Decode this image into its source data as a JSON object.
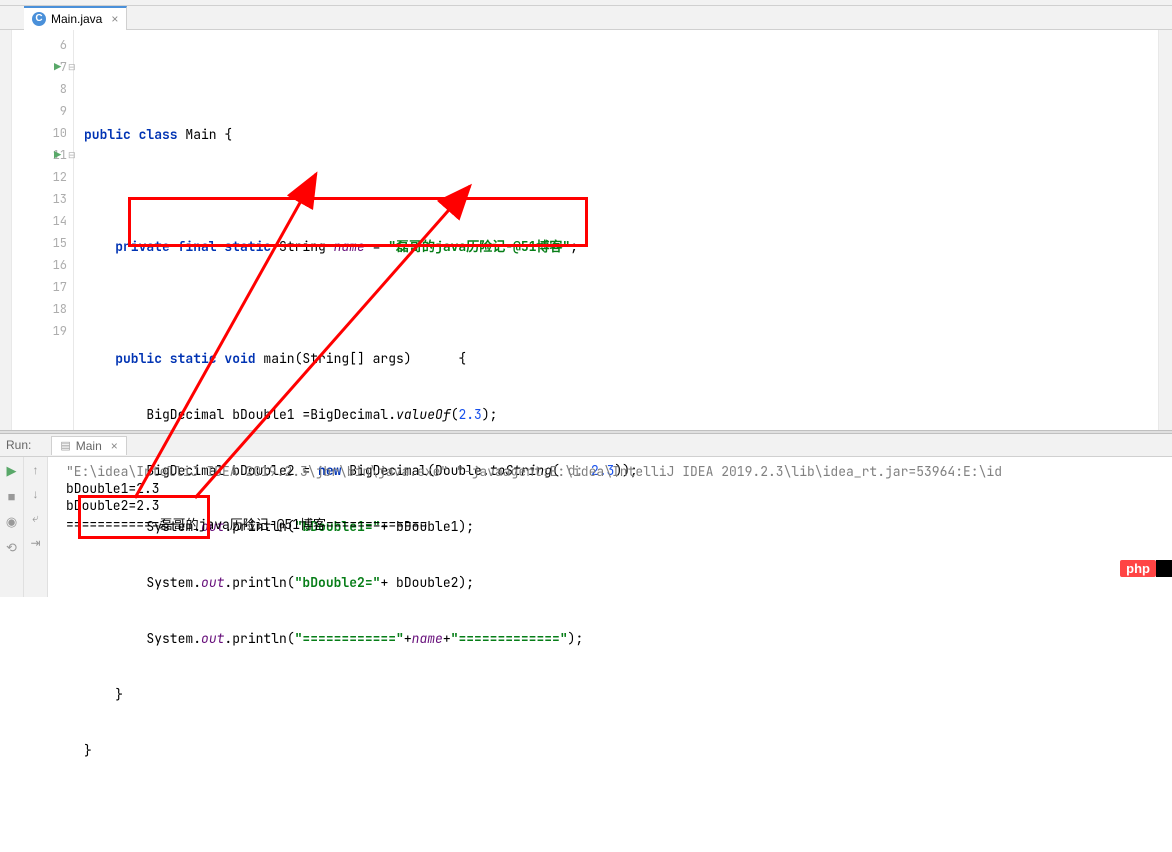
{
  "tab": {
    "label": "Main.java"
  },
  "gutter": [
    "6",
    "7",
    "8",
    "9",
    "10",
    "11",
    "12",
    "13",
    "14",
    "15",
    "16",
    "17",
    "18",
    "19",
    ""
  ],
  "run_markers": {
    "7": true,
    "11": true
  },
  "code": {
    "l7": {
      "a": "public class ",
      "b": "Main {"
    },
    "l9": {
      "a": "private final static ",
      "b": "String ",
      "c": "name",
      "d": " = ",
      "e": "\"磊哥的java历险记-@51博客\"",
      "f": ";"
    },
    "l11": {
      "a": "public static void ",
      "b": "main(String[] args)      {"
    },
    "l12": {
      "a": "BigDecimal bDouble1 =BigDecimal.",
      "b": "valueOf",
      "c": "(",
      "d": "2.3",
      "e": ");"
    },
    "l13": {
      "a": "BigDecimal bDouble2 = ",
      "b": "new ",
      "c": "BigDecimal(Double.",
      "d": "toString",
      "e": "( ",
      "f": "d: ",
      "g": "2.3",
      "h": "));"
    },
    "l14": {
      "a": "System.",
      "b": "out",
      "c": ".println(",
      "d": "\"bDouble1=\"",
      "e": "+ bDouble1);"
    },
    "l15": {
      "a": "System.",
      "b": "out",
      "c": ".println(",
      "d": "\"bDouble2=\"",
      "e": "+ bDouble2);"
    },
    "l16": {
      "a": "System.",
      "b": "out",
      "c": ".println(",
      "d": "\"============\"",
      "e": "+",
      "f": "name",
      "g": "+",
      "h": "\"=============\"",
      "i": ");"
    },
    "l17": "}",
    "l18": "}"
  },
  "runPanel": {
    "label": "Run:",
    "tab": "Main",
    "cmd": "\"E:\\idea\\IntelliJ IDEA 2019.2.3\\jbr\\bin\\java.exe\" \"-javaagent:E:\\idea\\IntelliJ IDEA 2019.2.3\\lib\\idea_rt.jar=53964:E:\\id",
    "out1": "bDouble1=2.3",
    "out2": "bDouble2=2.3",
    "out3": "============磊哥的java历险记-@51博客============="
  },
  "badge": "php"
}
